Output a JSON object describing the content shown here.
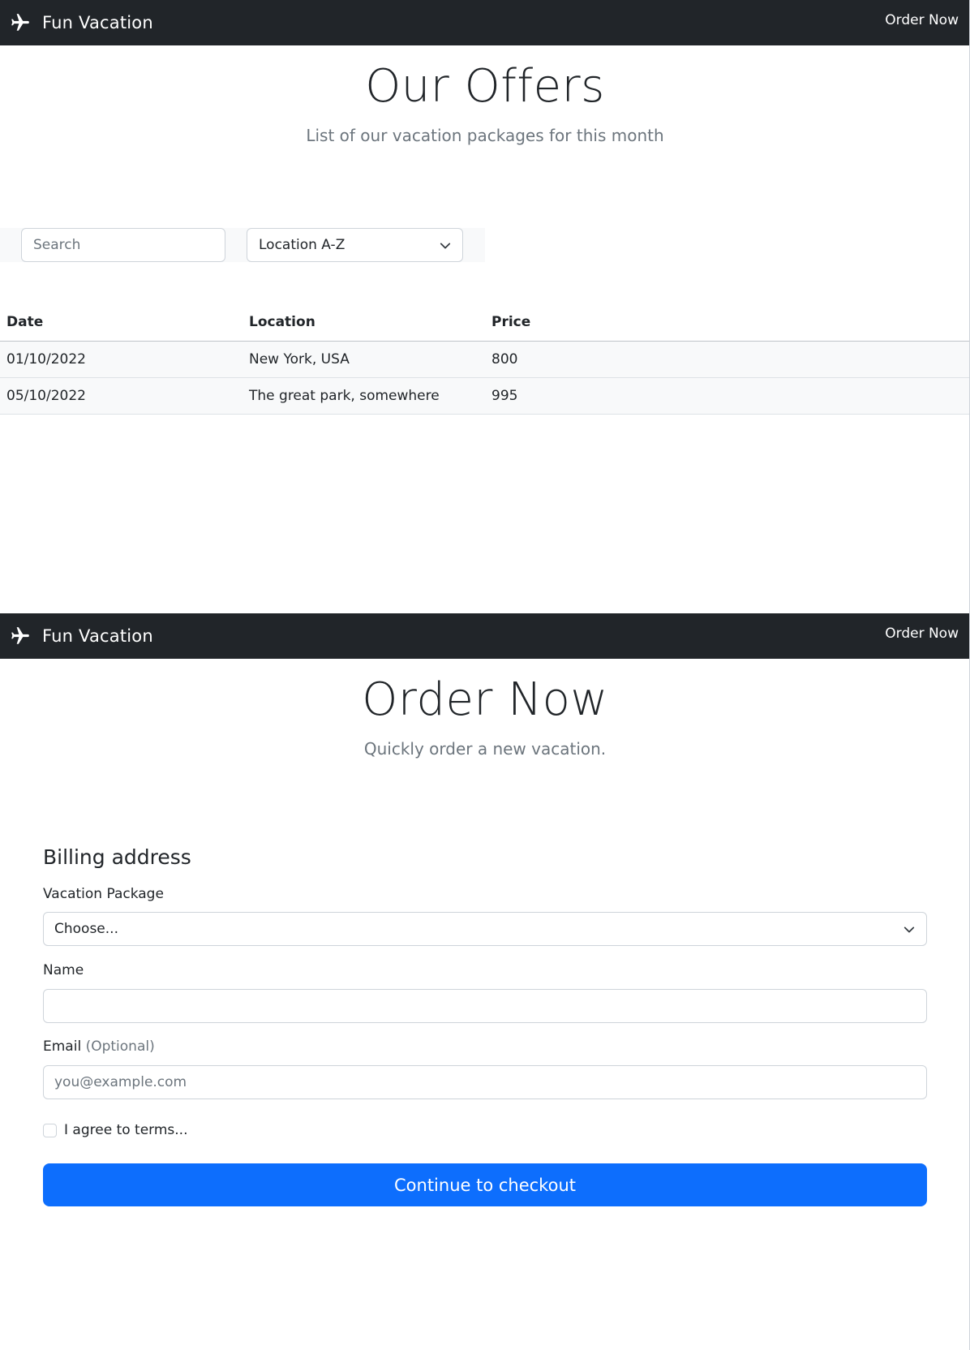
{
  "colors": {
    "navbar_bg": "#212529",
    "primary": "#0d6efd",
    "muted_text": "#6c757d",
    "border": "#ced4da",
    "row_bg": "#f8f9fa"
  },
  "offers_page": {
    "navbar": {
      "brand_icon": "airplane-icon",
      "brand": "Fun Vacation",
      "link": "Order Now"
    },
    "hero": {
      "title": "Our Offers",
      "subtitle": "List of our vacation packages for this month"
    },
    "filters": {
      "search_placeholder": "Search",
      "sort_value": "Location A-Z",
      "sort_icon": "chevron-down-icon"
    },
    "table": {
      "headers": [
        "Date",
        "Location",
        "Price"
      ],
      "rows": [
        [
          "01/10/2022",
          "New York, USA",
          "800"
        ],
        [
          "05/10/2022",
          "The great park, somewhere",
          "995"
        ]
      ]
    }
  },
  "order_page": {
    "navbar": {
      "brand_icon": "airplane-icon",
      "brand": "Fun Vacation",
      "link": "Order Now"
    },
    "hero": {
      "title": "Order Now",
      "subtitle": "Quickly order a new vacation."
    },
    "form": {
      "heading": "Billing address",
      "package_label": "Vacation Package",
      "package_value": "Choose...",
      "name_label": "Name",
      "name_value": "",
      "email_label": "Email",
      "email_optional": "(Optional)",
      "email_placeholder": "you@example.com",
      "terms_label": "I agree to terms...",
      "submit_label": "Continue to checkout"
    }
  }
}
